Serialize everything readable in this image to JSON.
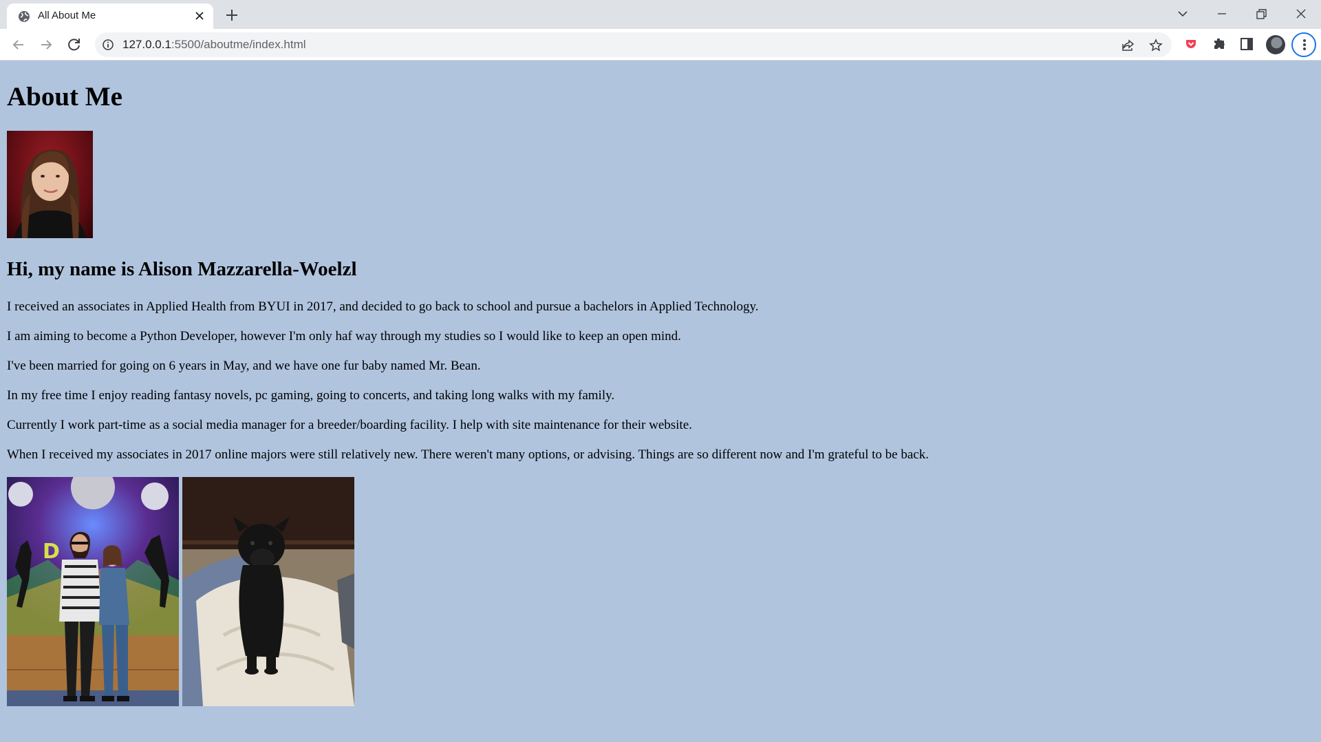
{
  "browser": {
    "tab_title": "All About Me",
    "url_host": "127.0.0.1",
    "url_rest": ":5500/aboutme/index.html"
  },
  "page": {
    "heading": "About Me",
    "subheading": "Hi, my name is Alison Mazzarella-Woelzl",
    "paragraphs": [
      "I received an associates in Applied Health from BYUI in 2017, and decided to go back to school and pursue a bachelors in Applied Technology.",
      "I am aiming to become a Python Developer, however I'm only haf way through my studies so I would like to keep an open mind.",
      "I've been married for going on 6 years in May, and we have one fur baby named Mr. Bean.",
      "In my free time I enjoy reading fantasy novels, pc gaming, going to concerts, and taking long walks with my family.",
      "Currently I work part-time as a social media manager for a breeder/boarding facility. I help with site maintenance for their website.",
      "When I received my associates in 2017 online majors were still relatively new. There weren't many options, or advising. Things are so different now and I'm grateful to be back."
    ]
  },
  "colors": {
    "page_background": "#b0c4de",
    "accent": "#1a73e8"
  }
}
